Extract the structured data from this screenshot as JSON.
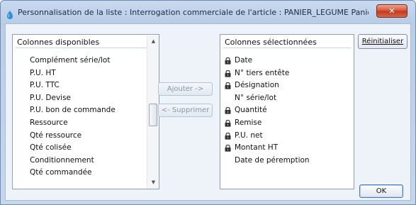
{
  "window": {
    "title": "Personnalisation de la liste : Interrogation commerciale de l'article : PANIER_LEGUME Panier de l...",
    "close_label": "✕"
  },
  "available": {
    "header": "Colonnes disponibles",
    "items": [
      {
        "label": "Complément série/lot"
      },
      {
        "label": "P.U. HT"
      },
      {
        "label": "P.U. TTC"
      },
      {
        "label": "P.U. Devise"
      },
      {
        "label": "P.U. bon de commande"
      },
      {
        "label": "Ressource"
      },
      {
        "label": "Qté ressource"
      },
      {
        "label": "Qté colisée"
      },
      {
        "label": "Conditionnement"
      },
      {
        "label": "Qté commandée"
      }
    ]
  },
  "selected": {
    "header": "Colonnes sélectionnées",
    "items": [
      {
        "label": "Date",
        "locked": true
      },
      {
        "label": "N° tiers entête",
        "locked": true
      },
      {
        "label": "Désignation",
        "locked": true
      },
      {
        "label": "N° série/lot",
        "locked": false
      },
      {
        "label": "Quantité",
        "locked": true
      },
      {
        "label": "Remise",
        "locked": true
      },
      {
        "label": "P.U. net",
        "locked": true
      },
      {
        "label": "Montant HT",
        "locked": true
      },
      {
        "label": "Date de péremption",
        "locked": false
      }
    ]
  },
  "buttons": {
    "add": "Ajouter ->",
    "remove": "<- Supprimer",
    "reset": "Réinitialiser",
    "ok": "OK"
  },
  "icons": {
    "app": "app-icon",
    "lock": "lock-icon",
    "scroll_up": "scroll-up-arrow-icon",
    "scroll_down": "scroll-down-arrow-icon"
  },
  "colors": {
    "window_frame": "#c6d7ec",
    "close_button": "#d9573b"
  }
}
